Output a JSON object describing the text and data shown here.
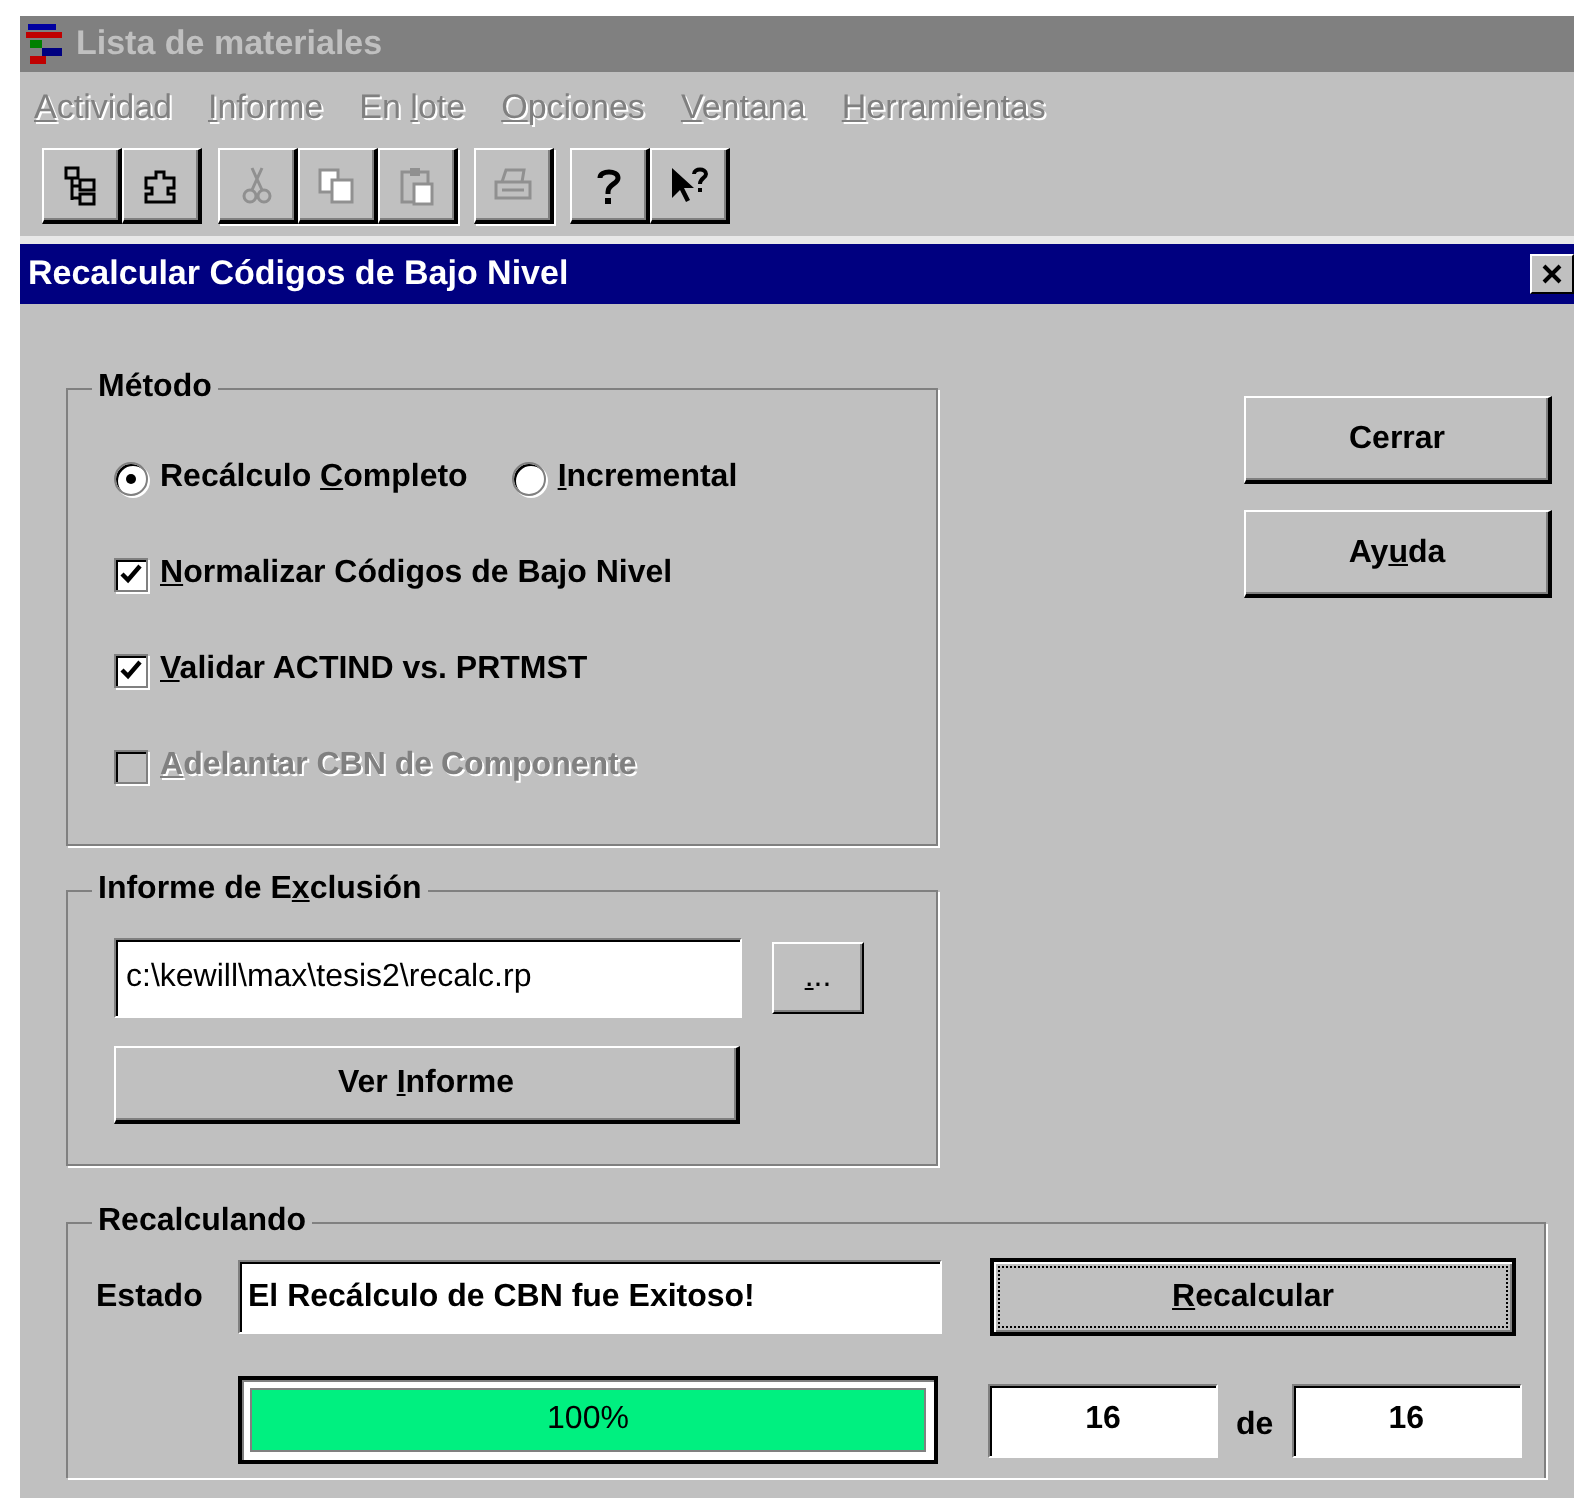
{
  "window": {
    "title": "Lista de materiales"
  },
  "menu": [
    {
      "parts": [
        {
          "text": "A",
          "underlined": true
        },
        {
          "text": "ctividad",
          "underlined": false
        }
      ],
      "disabled": true
    },
    {
      "parts": [
        {
          "text": "I",
          "underlined": true
        },
        {
          "text": "nforme",
          "underlined": false
        }
      ],
      "disabled": true
    },
    {
      "parts": [
        {
          "text": "En ",
          "underlined": false
        },
        {
          "text": "l",
          "underlined": true
        },
        {
          "text": "ote",
          "underlined": false
        }
      ],
      "disabled": true
    },
    {
      "parts": [
        {
          "text": "O",
          "underlined": true
        },
        {
          "text": "pciones",
          "underlined": false
        }
      ],
      "disabled": true
    },
    {
      "parts": [
        {
          "text": "V",
          "underlined": true
        },
        {
          "text": "entana",
          "underlined": false
        }
      ],
      "disabled": true
    },
    {
      "parts": [
        {
          "text": "H",
          "underlined": true
        },
        {
          "text": "erramientas",
          "underlined": false
        }
      ],
      "disabled": true
    }
  ],
  "toolbar_groups": [
    [
      {
        "kind": "tree",
        "disabled": false
      },
      {
        "kind": "puzzle",
        "disabled": false
      }
    ],
    [
      {
        "kind": "cut",
        "disabled": true
      },
      {
        "kind": "copy",
        "disabled": true
      },
      {
        "kind": "paste",
        "disabled": true
      }
    ],
    [
      {
        "kind": "print",
        "disabled": true
      }
    ],
    [
      {
        "kind": "help",
        "disabled": false
      },
      {
        "kind": "context-help",
        "disabled": false
      }
    ]
  ],
  "dialog": {
    "title": "Recalcular Códigos de Bajo Nivel"
  },
  "method": {
    "title": "Método",
    "options": [
      {
        "kind": "radio",
        "parts": [
          {
            "text": "Recálculo ",
            "underlined": false
          },
          {
            "text": "C",
            "underlined": true
          },
          {
            "text": "ompleto",
            "underlined": false
          }
        ],
        "selected": true
      },
      {
        "kind": "radio",
        "parts": [
          {
            "text": "I",
            "underlined": true
          },
          {
            "text": "ncremental",
            "underlined": false
          }
        ],
        "selected": false
      },
      {
        "kind": "checkbox",
        "parts": [
          {
            "text": "N",
            "underlined": true
          },
          {
            "text": "ormalizar Códigos de Bajo Nivel",
            "underlined": false
          }
        ],
        "checked": true,
        "disabled": false
      },
      {
        "kind": "checkbox",
        "parts": [
          {
            "text": "V",
            "underlined": true
          },
          {
            "text": "alidar ACTIND vs. PRTMST",
            "underlined": false
          }
        ],
        "checked": true,
        "disabled": false
      },
      {
        "kind": "checkbox",
        "parts": [
          {
            "text": "A",
            "underlined": true
          },
          {
            "text": "delantar CBN de Componente",
            "underlined": false
          }
        ],
        "checked": false,
        "disabled": true
      }
    ]
  },
  "side_buttons": [
    {
      "parts": [
        {
          "text": "Cerrar",
          "underlined": false
        }
      ]
    },
    {
      "parts": [
        {
          "text": "Ay",
          "underlined": false
        },
        {
          "text": "u",
          "underlined": true
        },
        {
          "text": "da",
          "underlined": false
        }
      ]
    }
  ],
  "report": {
    "title": [
      {
        "text": "Informe de E",
        "underlined": false
      },
      {
        "text": "x",
        "underlined": true
      },
      {
        "text": "clusión",
        "underlined": false
      }
    ],
    "path": "c:\\kewill\\max\\tesis2\\recalc.rp",
    "browse": [
      {
        "text": ".",
        "underlined": true
      },
      {
        "text": "..",
        "underlined": false
      }
    ],
    "view": [
      {
        "text": "Ver ",
        "underlined": false
      },
      {
        "text": "I",
        "underlined": true
      },
      {
        "text": "nforme",
        "underlined": false
      }
    ]
  },
  "recalc": {
    "title": "Recalculando",
    "status_label": "Estado",
    "status": "El Recálculo de CBN fue Exitoso!",
    "button": {
      "parts": [
        {
          "text": "R",
          "underlined": true
        },
        {
          "text": "ecalcular",
          "underlined": false
        }
      ],
      "focused": true
    },
    "progress": {
      "level": 1,
      "text": "100%"
    },
    "current": "16",
    "of": "de",
    "total": "16"
  }
}
